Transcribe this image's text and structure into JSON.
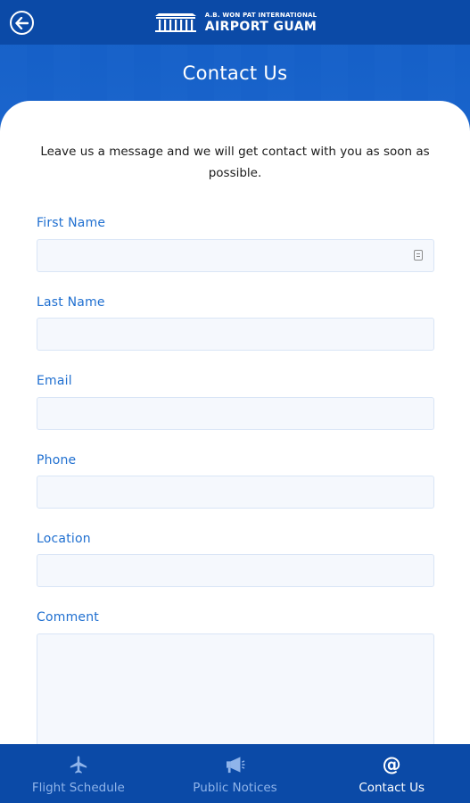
{
  "header": {
    "logo_small": "A.B. WON PAT INTERNATIONAL",
    "logo_big": "AIRPORT GUAM",
    "title": "Contact Us"
  },
  "intro_text": "Leave us a message and we will get contact with you as soon as possible.",
  "form": {
    "first_name_label": "First Name",
    "first_name_value": "",
    "last_name_label": "Last Name",
    "last_name_value": "",
    "email_label": "Email",
    "email_value": "",
    "phone_label": "Phone",
    "phone_value": "",
    "location_label": "Location",
    "location_value": "",
    "comment_label": "Comment",
    "comment_value": ""
  },
  "nav": {
    "flight_schedule": "Flight Schedule",
    "public_notices": "Public Notices",
    "contact_us": "Contact Us",
    "active": "contact_us"
  },
  "colors": {
    "header_blue": "#0b4aa7",
    "label_blue": "#1f6fd0",
    "inactive_nav": "#8fb4ea"
  }
}
